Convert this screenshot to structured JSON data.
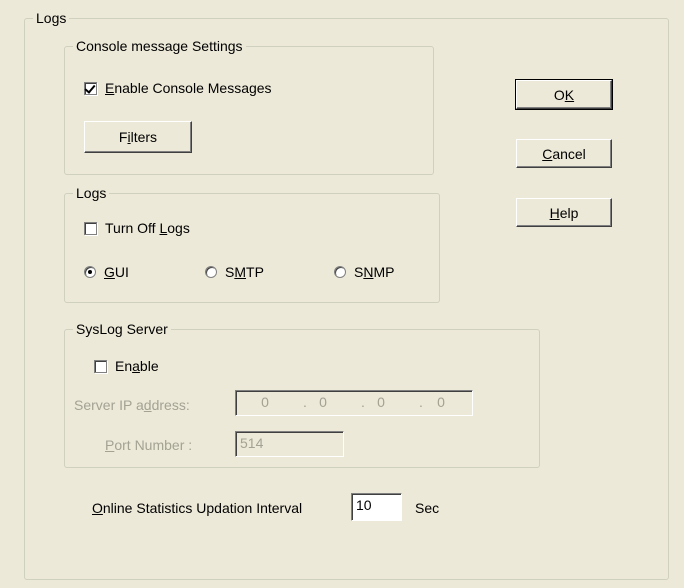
{
  "logs_group": {
    "title": "Logs"
  },
  "console": {
    "title": "Console message Settings",
    "enable_label": "Enable Console Messages",
    "enable_checked": true,
    "filters_button": "Filters"
  },
  "logs_inner": {
    "title": "Logs",
    "turn_off_label": "Turn Off Logs",
    "turn_off_checked": false,
    "radios": [
      {
        "label": "GUI",
        "selected": true
      },
      {
        "label": "SMTP",
        "selected": false
      },
      {
        "label": "SNMP",
        "selected": false
      }
    ]
  },
  "syslog": {
    "title": "SysLog Server",
    "enable_label": "Enable",
    "enable_checked": false,
    "ip_label": "Server IP address:",
    "ip_octets": [
      "0",
      "0",
      "0",
      "0"
    ],
    "port_label": "Port Number :",
    "port_value": "514"
  },
  "interval": {
    "label": "Online Statistics Updation Interval",
    "value": "10",
    "unit": "Sec"
  },
  "buttons": {
    "ok": "OK",
    "cancel": "Cancel",
    "help": "Help"
  }
}
